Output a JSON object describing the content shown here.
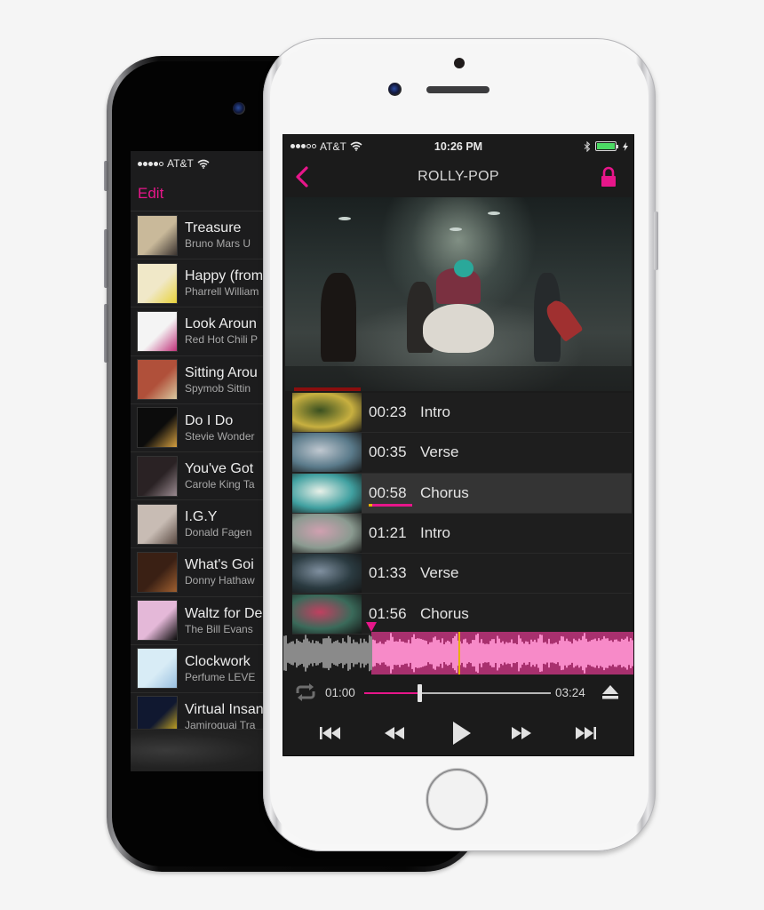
{
  "back_phone": {
    "status": {
      "carrier": "AT&T",
      "signal_bars": 4,
      "signal_total": 5
    },
    "nav": {
      "edit_label": "Edit"
    },
    "songs": [
      {
        "title": "Treasure",
        "subtitle": "Bruno Mars   U",
        "art_colors": [
          "#c9b99a",
          "#3c3430"
        ]
      },
      {
        "title": "Happy (from",
        "subtitle": "Pharrell William",
        "art_colors": [
          "#f0e8c8",
          "#e8d23a"
        ]
      },
      {
        "title": "Look Aroun",
        "subtitle": "Red Hot Chili P",
        "art_colors": [
          "#f4f4f4",
          "#c0337a"
        ]
      },
      {
        "title": "Sitting Arou",
        "subtitle": "Spymob   Sittin",
        "art_colors": [
          "#b0503a",
          "#d9c9a0"
        ]
      },
      {
        "title": "Do I Do",
        "subtitle": "Stevie Wonder",
        "art_colors": [
          "#0c0c0c",
          "#d6a040"
        ]
      },
      {
        "title": "You've Got",
        "subtitle": "Carole King   Ta",
        "art_colors": [
          "#2a2224",
          "#9a8a90"
        ]
      },
      {
        "title": "I.G.Y",
        "subtitle": "Donald Fagen",
        "art_colors": [
          "#c8bcb4",
          "#5a4a42"
        ]
      },
      {
        "title": "What's Goi",
        "subtitle": "Donny Hathaw",
        "art_colors": [
          "#3a2014",
          "#a06030"
        ]
      },
      {
        "title": "Waltz for De",
        "subtitle": "The Bill Evans",
        "art_colors": [
          "#e4b8d8",
          "#0a0a0a"
        ]
      },
      {
        "title": "Clockwork",
        "subtitle": "Perfume   LEVE",
        "art_colors": [
          "#d8ecf6",
          "#9ac0e0"
        ]
      },
      {
        "title": "Virtual Insan",
        "subtitle": "Jamiroquai   Tra",
        "art_colors": [
          "#101830",
          "#e8c020"
        ]
      }
    ]
  },
  "front_phone": {
    "status": {
      "carrier": "AT&T",
      "signal_bars": 3,
      "signal_total": 5,
      "time": "10:26 PM",
      "battery_percent": 100,
      "charging": true
    },
    "nav": {
      "title": "ROLLY-POP",
      "back_icon": "chevron-left-icon",
      "lock_icon": "lock-icon"
    },
    "video": {
      "progress_fraction": 0.2
    },
    "chapters": [
      {
        "time": "00:23",
        "label": "Intro",
        "active": false,
        "thumb_colors": [
          "#c8b040",
          "#3a5020"
        ]
      },
      {
        "time": "00:35",
        "label": "Verse",
        "active": false,
        "thumb_colors": [
          "#5a7a8a",
          "#c0c8d0"
        ]
      },
      {
        "time": "00:58",
        "label": "Chorus",
        "active": true,
        "thumb_colors": [
          "#40a0a0",
          "#e8f0e8"
        ]
      },
      {
        "time": "01:21",
        "label": "Intro",
        "active": false,
        "thumb_colors": [
          "#8a9a90",
          "#d0a0b0"
        ]
      },
      {
        "time": "01:33",
        "label": "Verse",
        "active": false,
        "thumb_colors": [
          "#2a3a40",
          "#8090a0"
        ]
      },
      {
        "time": "01:56",
        "label": "Chorus",
        "active": false,
        "thumb_colors": [
          "#3a6a5a",
          "#c04060"
        ]
      }
    ],
    "waveform": {
      "loop_start_fraction": 0.25,
      "playhead_fraction": 0.5
    },
    "transport": {
      "current_time": "01:00",
      "total_time": "03:24",
      "progress_fraction": 0.294,
      "repeat_icon": "repeat-icon",
      "eject_icon": "eject-icon"
    },
    "controls": [
      {
        "name": "skip-to-start",
        "icon": "skip-back-icon"
      },
      {
        "name": "rewind",
        "icon": "rewind-icon"
      },
      {
        "name": "play",
        "icon": "play-icon"
      },
      {
        "name": "fast-forward",
        "icon": "fast-forward-icon"
      },
      {
        "name": "skip-to-end",
        "icon": "skip-forward-icon"
      }
    ]
  },
  "colors": {
    "accent": "#e7168a",
    "waveform_active": "#f78ac8",
    "waveform_active_dark": "#a8306e",
    "waveform_inactive": "#8a8a8a",
    "playhead": "#e8b000",
    "battery": "#4cd964"
  }
}
